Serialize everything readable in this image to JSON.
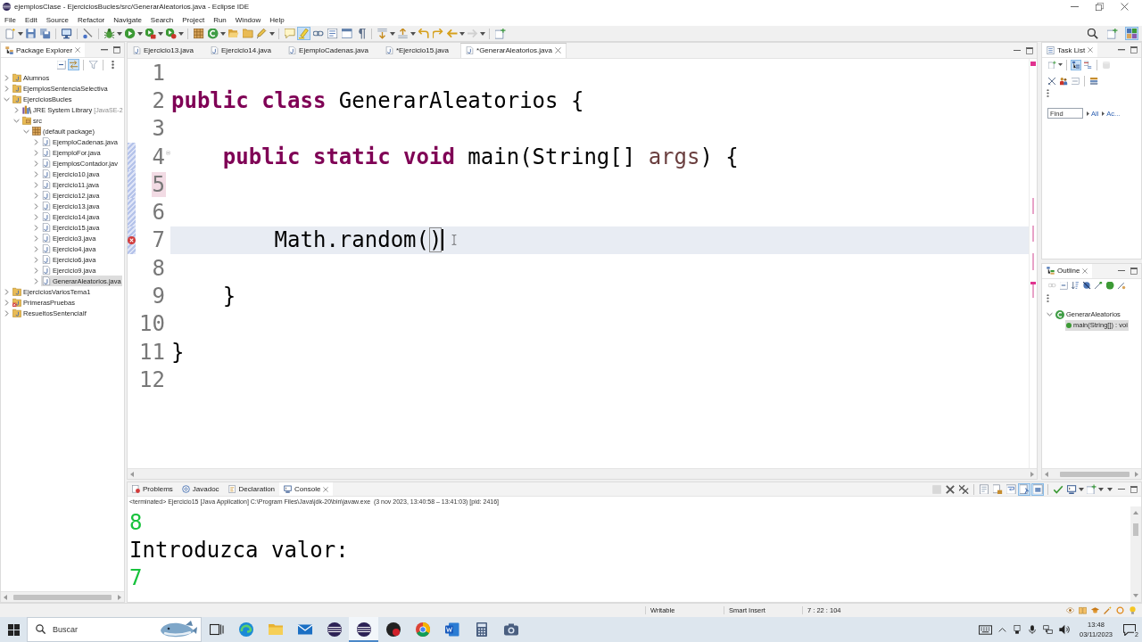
{
  "window": {
    "title": "ejemplosClase - EjerciciosBucles/src/GenerarAleatorios.java - Eclipse IDE"
  },
  "menu": [
    "File",
    "Edit",
    "Source",
    "Refactor",
    "Navigate",
    "Search",
    "Project",
    "Run",
    "Window",
    "Help"
  ],
  "toolbar": {
    "groups": [
      [
        {
          "menu": true,
          "pressed": false,
          "disabled": false
        },
        {
          "menu": false,
          "pressed": false,
          "disabled": false
        },
        {
          "menu": false,
          "pressed": false,
          "disabled": false
        }
      ],
      [
        {
          "menu": false,
          "pressed": false,
          "disabled": false
        }
      ],
      [
        {
          "menu": false,
          "pressed": false,
          "disabled": false
        }
      ],
      [
        {
          "menu": true,
          "pressed": false,
          "disabled": false
        },
        {
          "menu": true,
          "pressed": false,
          "disabled": false
        },
        {
          "menu": true,
          "pressed": false,
          "disabled": false
        },
        {
          "menu": true,
          "pressed": false,
          "disabled": false
        }
      ],
      [
        {
          "menu": false,
          "pressed": false,
          "disabled": false
        },
        {
          "menu": true,
          "pressed": false,
          "disabled": false
        },
        {
          "menu": false,
          "pressed": false,
          "disabled": false
        },
        {
          "menu": false,
          "pressed": false,
          "disabled": false
        },
        {
          "menu": true,
          "pressed": false,
          "disabled": false
        }
      ],
      [
        {
          "menu": false,
          "pressed": false,
          "disabled": false
        },
        {
          "menu": false,
          "pressed": true,
          "disabled": false
        },
        {
          "menu": false,
          "pressed": false,
          "disabled": false
        },
        {
          "menu": false,
          "pressed": false,
          "disabled": false
        },
        {
          "menu": false,
          "pressed": false,
          "disabled": false
        },
        {
          "menu": false,
          "pressed": false,
          "disabled": false
        }
      ],
      [
        {
          "menu": true,
          "pressed": false,
          "disabled": false
        },
        {
          "menu": true,
          "pressed": false,
          "disabled": false
        },
        {
          "menu": false,
          "pressed": false,
          "disabled": false
        },
        {
          "menu": false,
          "pressed": false,
          "disabled": false
        },
        {
          "menu": true,
          "pressed": false,
          "disabled": false
        },
        {
          "menu": true,
          "pressed": false,
          "disabled": true
        }
      ],
      [
        {
          "menu": false,
          "pressed": false,
          "disabled": false
        }
      ]
    ],
    "right": [
      {
        "menu": false,
        "pressed": false,
        "disabled": false
      },
      {
        "menu": false,
        "pressed": false,
        "disabled": false
      },
      {
        "menu": false,
        "pressed": true,
        "disabled": false
      }
    ]
  },
  "package_explorer": {
    "title": "Package Explorer",
    "toolbar": [
      [
        {
          "menu": false,
          "pressed": false,
          "disabled": false
        },
        {
          "menu": false,
          "pressed": true,
          "disabled": false
        }
      ],
      [
        {
          "menu": false,
          "pressed": false,
          "disabled": false
        }
      ],
      [
        {
          "menu": false,
          "pressed": false,
          "disabled": false
        }
      ]
    ],
    "tree": [
      {
        "label": "Alumnos",
        "kind": "project",
        "expanded": false,
        "selected": false,
        "error": false
      },
      {
        "label": "EjemplosSentenciaSelectiva",
        "kind": "project",
        "expanded": false,
        "selected": false,
        "error": false
      },
      {
        "label": "EjerciciosBucles",
        "kind": "project",
        "expanded": true,
        "selected": false,
        "error": false,
        "children": [
          {
            "label": "JRE System Library",
            "detail": "[JavaSE-2",
            "kind": "library",
            "expanded": false,
            "selected": false
          },
          {
            "label": "src",
            "kind": "source_folder",
            "expanded": true,
            "selected": false,
            "children": [
              {
                "label": "(default package)",
                "kind": "package",
                "expanded": true,
                "selected": false,
                "children": [
                  {
                    "label": "EjemploCadenas.java",
                    "kind": "file",
                    "expanded": false,
                    "selected": false
                  },
                  {
                    "label": "EjemploFor.java",
                    "kind": "file",
                    "expanded": false,
                    "selected": false
                  },
                  {
                    "label": "EjemplosContador.jav",
                    "kind": "file",
                    "expanded": false,
                    "selected": false
                  },
                  {
                    "label": "Ejercicio10.java",
                    "kind": "file",
                    "expanded": false,
                    "selected": false
                  },
                  {
                    "label": "Ejercicio11.java",
                    "kind": "file",
                    "expanded": false,
                    "selected": false
                  },
                  {
                    "label": "Ejercicio12.java",
                    "kind": "file",
                    "expanded": false,
                    "selected": false
                  },
                  {
                    "label": "Ejercicio13.java",
                    "kind": "file",
                    "expanded": false,
                    "selected": false
                  },
                  {
                    "label": "Ejercicio14.java",
                    "kind": "file",
                    "expanded": false,
                    "selected": false
                  },
                  {
                    "label": "Ejercicio15.java",
                    "kind": "file",
                    "expanded": false,
                    "selected": false
                  },
                  {
                    "label": "Ejercicio3.java",
                    "kind": "file",
                    "expanded": false,
                    "selected": false
                  },
                  {
                    "label": "Ejercicio4.java",
                    "kind": "file",
                    "expanded": false,
                    "selected": false
                  },
                  {
                    "label": "Ejercicio6.java",
                    "kind": "file",
                    "expanded": false,
                    "selected": false
                  },
                  {
                    "label": "Ejercicio9.java",
                    "kind": "file",
                    "expanded": false,
                    "selected": false
                  },
                  {
                    "label": "GenerarAleatorios.java",
                    "kind": "file",
                    "expanded": false,
                    "selected": true
                  }
                ]
              }
            ]
          }
        ]
      },
      {
        "label": "EjerciciosVariosTema1",
        "kind": "project",
        "expanded": false,
        "selected": false,
        "error": false
      },
      {
        "label": "PrimerasPruebas",
        "kind": "project",
        "expanded": false,
        "selected": false,
        "error": true
      },
      {
        "label": "ResueltosSentenciaIf",
        "kind": "project",
        "expanded": false,
        "selected": false,
        "error": false
      }
    ]
  },
  "editor": {
    "tabs": [
      {
        "label": "Ejercicio13.java",
        "selected": false
      },
      {
        "label": "Ejercicio14.java",
        "selected": false
      },
      {
        "label": "EjemploCadenas.java",
        "selected": false
      },
      {
        "label": "*Ejercicio15.java",
        "selected": false
      },
      {
        "label": "*GenerarAleatorios.java",
        "selected": true
      }
    ],
    "lines": [
      {
        "number": "1",
        "changed": false,
        "marked": false,
        "error": false,
        "current": false,
        "folding": false
      },
      {
        "number": "2",
        "changed": false,
        "marked": false,
        "error": false,
        "current": false,
        "folding": false,
        "tokens": [
          {
            "text": "public ",
            "kind": "keyword"
          },
          {
            "text": "class ",
            "kind": "keyword"
          },
          {
            "text": "GenerarAleatorios {",
            "kind": "plain"
          }
        ]
      },
      {
        "number": "3",
        "changed": false,
        "marked": false,
        "error": false,
        "current": false,
        "folding": false
      },
      {
        "number": "4",
        "changed": true,
        "marked": false,
        "error": false,
        "current": false,
        "folding": true,
        "tokens": [
          {
            "text": "    public ",
            "kind": "keyword"
          },
          {
            "text": "static ",
            "kind": "keyword"
          },
          {
            "text": "void ",
            "kind": "keyword"
          },
          {
            "text": "main(String[] ",
            "kind": "plain"
          },
          {
            "text": "args",
            "kind": "parameter"
          },
          {
            "text": ") {",
            "kind": "plain"
          }
        ]
      },
      {
        "number": "5",
        "changed": true,
        "marked": true,
        "error": false,
        "current": false,
        "folding": false
      },
      {
        "number": "6",
        "changed": true,
        "marked": false,
        "error": false,
        "current": false,
        "folding": false
      },
      {
        "number": "7",
        "changed": true,
        "marked": false,
        "error": true,
        "current": true,
        "folding": false,
        "tokens": [
          {
            "text": "        Math.random(",
            "kind": "plain"
          },
          {
            "text": ")",
            "kind": "matched"
          }
        ]
      },
      {
        "number": "8",
        "changed": false,
        "marked": false,
        "error": false,
        "current": false,
        "folding": false
      },
      {
        "number": "9",
        "changed": false,
        "marked": false,
        "error": false,
        "current": false,
        "folding": false,
        "tokens": [
          {
            "text": "    }",
            "kind": "plain"
          }
        ]
      },
      {
        "number": "10",
        "changed": false,
        "marked": false,
        "error": false,
        "current": false,
        "folding": false
      },
      {
        "number": "11",
        "changed": false,
        "marked": false,
        "error": false,
        "current": false,
        "folding": false,
        "tokens": [
          {
            "text": "}",
            "kind": "plain"
          }
        ]
      },
      {
        "number": "12",
        "changed": false,
        "marked": false,
        "error": false,
        "current": false,
        "folding": false
      }
    ]
  },
  "task_list": {
    "title": "Task List",
    "toolbar": [
      [
        {
          "menu": true,
          "pressed": false,
          "disabled": false
        }
      ],
      [
        {
          "menu": false,
          "pressed": true,
          "disabled": false
        },
        {
          "menu": false,
          "pressed": false,
          "disabled": false
        }
      ],
      [
        {
          "menu": false,
          "pressed": false,
          "disabled": true
        }
      ]
    ],
    "toolbar_2": [
      [
        {
          "menu": false,
          "pressed": false,
          "disabled": false
        },
        {
          "menu": false,
          "pressed": false,
          "disabled": false
        },
        {
          "menu": false,
          "pressed": false,
          "disabled": false
        }
      ],
      [
        {
          "menu": false,
          "pressed": false,
          "disabled": false
        }
      ]
    ],
    "find": {
      "placeholder": "Find"
    },
    "links": [
      "All",
      "Ac..."
    ]
  },
  "outline": {
    "title": "Outline",
    "toolbar": [
      [
        {
          "menu": false,
          "pressed": false,
          "disabled": true
        },
        {
          "menu": false,
          "pressed": false,
          "disabled": false
        },
        {
          "menu": false,
          "pressed": false,
          "disabled": false
        },
        {
          "menu": false,
          "pressed": false,
          "disabled": false
        },
        {
          "menu": false,
          "pressed": false,
          "disabled": false
        },
        {
          "menu": false,
          "pressed": false,
          "disabled": false
        },
        {
          "menu": false,
          "pressed": false,
          "disabled": false
        }
      ]
    ],
    "tree": [
      {
        "label": "GenerarAleatorios",
        "kind": "class",
        "expanded": true,
        "selected": false,
        "children": [
          {
            "label": "main(String[]) : voi",
            "kind": "method",
            "selected": true
          }
        ]
      }
    ]
  },
  "console": {
    "tabs": [
      {
        "label": "Problems",
        "selected": false
      },
      {
        "label": "Javadoc",
        "selected": false
      },
      {
        "label": "Declaration",
        "selected": false
      },
      {
        "label": "Console",
        "selected": true
      }
    ],
    "toolbar": [
      [
        {
          "menu": false,
          "pressed": false,
          "disabled": true
        },
        {
          "menu": false,
          "pressed": false,
          "disabled": false
        },
        {
          "menu": false,
          "pressed": false,
          "disabled": false
        }
      ],
      [
        {
          "menu": false,
          "pressed": false,
          "disabled": false
        },
        {
          "menu": false,
          "pressed": false,
          "disabled": false
        },
        {
          "menu": false,
          "pressed": false,
          "disabled": false
        },
        {
          "menu": false,
          "pressed": true,
          "disabled": false
        },
        {
          "menu": false,
          "pressed": true,
          "disabled": false
        }
      ],
      [
        {
          "menu": false,
          "pressed": false,
          "disabled": false
        },
        {
          "menu": true,
          "pressed": false,
          "disabled": false
        },
        {
          "menu": true,
          "pressed": false,
          "disabled": false
        }
      ]
    ],
    "process": "<terminated> Ejercicio15 [Java Application] C:\\Program Files\\Java\\jdk-20\\bin\\javaw.exe  (3 nov 2023, 13:40:58 – 13:41:03) [pid: 2416]",
    "lines": [
      {
        "text": "8",
        "kind": "input"
      },
      {
        "text": "Introduzca valor:",
        "kind": "output"
      },
      {
        "text": "7",
        "kind": "input"
      }
    ]
  },
  "status_bar": {
    "mode": "Writable",
    "insert_mode": "Smart Insert",
    "position": "7 : 22 : 104"
  },
  "taskbar": {
    "search": {
      "placeholder": "Buscar"
    },
    "apps": [
      {
        "selected": false
      },
      {
        "selected": false
      },
      {
        "selected": false
      },
      {
        "selected": false
      },
      {
        "selected": false
      },
      {
        "selected": true
      },
      {
        "selected": false
      },
      {
        "selected": false
      },
      {
        "selected": false
      },
      {
        "selected": false
      },
      {
        "selected": false
      }
    ],
    "clock": {
      "time": "13:48",
      "date": "03/11/2023"
    },
    "notifications": "2"
  }
}
